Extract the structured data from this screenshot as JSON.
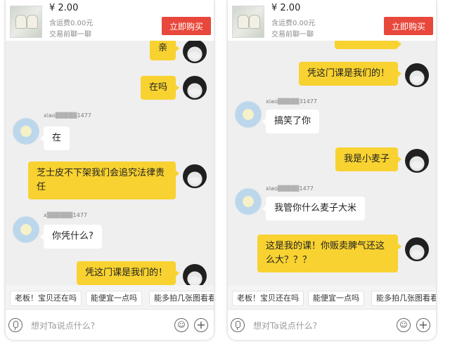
{
  "screens": [
    {
      "product": {
        "price": "¥ 2.00",
        "shipping": "含运费0.00元",
        "chat_hint": "交易前聊一聊",
        "buy_label": "立即购买"
      },
      "messages": [
        {
          "side": "mine",
          "text": "亲"
        },
        {
          "side": "mine",
          "text": "在吗"
        },
        {
          "side": "other",
          "sender": "xiao▒▒▒▒▒1477",
          "text": "在"
        },
        {
          "side": "mine",
          "text": "芝士皮不下架我们会追究法律责任"
        },
        {
          "side": "other",
          "sender": "x▒▒▒▒▒▒1477",
          "text": "你凭什么?"
        },
        {
          "side": "mine",
          "text": "凭这门课是我们的！"
        }
      ],
      "quick_replies": [
        "老板！宝贝还在吗",
        "能便宜一点吗",
        "能多拍几张图看看"
      ],
      "input_placeholder": "想对Ta说点什么?"
    },
    {
      "product": {
        "price": "¥ 2.00",
        "shipping": "含运费0.00元",
        "chat_hint": "交易前聊一聊",
        "buy_label": "立即购买"
      },
      "messages": [
        {
          "side": "mine",
          "text": "凭这门课是我们的！"
        },
        {
          "side": "other",
          "sender": "xiao▒▒▒▒▒31477",
          "text": "搞笑了你"
        },
        {
          "side": "mine",
          "text": "我是小麦子"
        },
        {
          "side": "other",
          "sender": "xiao▒▒▒▒▒1477",
          "text": "我管你什么麦子大米"
        },
        {
          "side": "mine",
          "text": "这是我的课！你贩卖脾气还这么大？？？"
        }
      ],
      "quick_replies": [
        "老板！宝贝还在吗",
        "能便宜一点吗",
        "能多拍几张图看看"
      ],
      "input_placeholder": "想对Ta说点什么?"
    }
  ],
  "colors": {
    "mine_bubble": "#f8d230",
    "other_bubble": "#ffffff",
    "buy_button": "#e8473b",
    "chat_bg": "#efefef"
  },
  "icons": {
    "mic": "microphone-icon",
    "emoji": "emoji-icon",
    "plus": "plus-icon"
  }
}
